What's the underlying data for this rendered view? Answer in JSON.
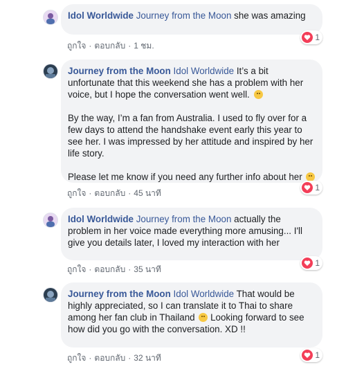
{
  "comments": [
    {
      "author": "Idol Worldwide",
      "tag": "Journey from the Moon",
      "paragraphs": [
        " she was amazing"
      ],
      "reaction_count": "1",
      "like_label": "ถูกใจ",
      "reply_label": "ตอบกลับ",
      "time": "1 ชม."
    },
    {
      "author": "Journey from the Moon",
      "tag": "Idol Worldwide",
      "paragraphs": [
        " It’s a bit unfortunate that this weekend she has a problem with her voice, but I hope the conversation went well.",
        "By the way, I’m a fan from Australia. I used to fly over for a few days to attend the handshake event early this year to see her. I was impressed by her attitude and inspired by her life story.",
        "Please let me know if you need any further info about her"
      ],
      "reaction_count": "1",
      "like_label": "ถูกใจ",
      "reply_label": "ตอบกลับ",
      "time": "45 นาที"
    },
    {
      "author": "Idol Worldwide",
      "tag": "Journey from the Moon",
      "paragraphs": [
        " actually the problem in her voice made everything more amusing... I'll give you details later, I loved my interaction with her"
      ],
      "reaction_count": "1",
      "like_label": "ถูกใจ",
      "reply_label": "ตอบกลับ",
      "time": "35 นาที"
    },
    {
      "author": "Journey from the Moon",
      "tag": "Idol Worldwide",
      "paragraphs": [
        " That would be highly appreciated, so I can translate it to Thai to share among her fan club in Thailand",
        " Looking forward to see how did you go with the conversation. XD !!"
      ],
      "reaction_count": "1",
      "like_label": "ถูกใจ",
      "reply_label": "ตอบกลับ",
      "time": "32 นาที"
    }
  ],
  "colors": {
    "link": "#385898",
    "bubble": "#f2f3f5",
    "heart": "#f33e58",
    "meta": "#606770"
  },
  "icons": {
    "reaction": "heart-icon",
    "emoji": "smile-emoji-icon"
  }
}
